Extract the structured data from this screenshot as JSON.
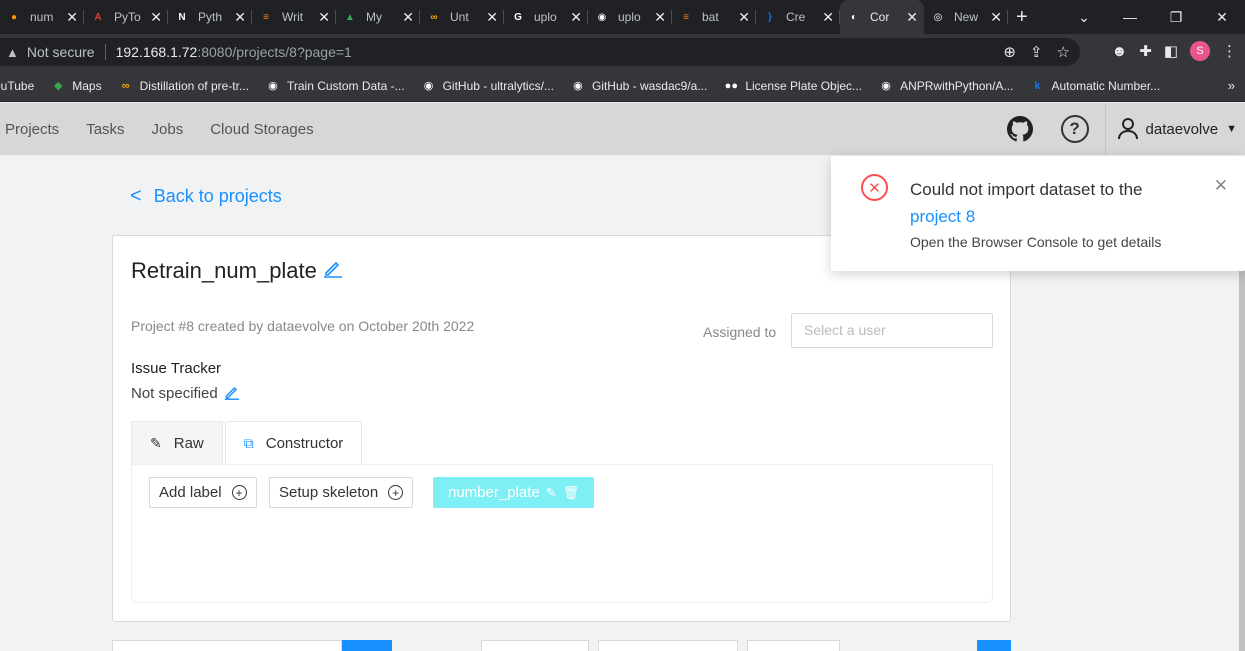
{
  "browser": {
    "tabs": [
      {
        "label": "num",
        "fav_color": "#f29900",
        "fav_char": "●"
      },
      {
        "label": "PyTo",
        "fav_color": "#e53935",
        "fav_char": "A"
      },
      {
        "label": "Pyth",
        "fav_color": "#ffffff",
        "fav_char": "N"
      },
      {
        "label": "Writ",
        "fav_color": "#f48024",
        "fav_char": "≡"
      },
      {
        "label": "My",
        "fav_color": "#34a853",
        "fav_char": "▲"
      },
      {
        "label": "Unt",
        "fav_color": "#f9ab00",
        "fav_char": "∞"
      },
      {
        "label": "uplo",
        "fav_color": "#ffffff",
        "fav_char": "G"
      },
      {
        "label": "uplo",
        "fav_color": "#ffffff",
        "fav_char": "◉"
      },
      {
        "label": "bat",
        "fav_color": "#f48024",
        "fav_char": "≡"
      },
      {
        "label": "Cre",
        "fav_color": "#1a73e8",
        "fav_char": "}"
      },
      {
        "label": "Cor",
        "fav_color": "#ffffff",
        "fav_char": "◐"
      },
      {
        "label": "New",
        "fav_color": "#ffffff",
        "fav_char": "◎"
      }
    ],
    "new_tab": "+",
    "address": {
      "not_secure": "Not secure",
      "host": "192.168.1.72",
      "path": ":8080/projects/8?page=1"
    },
    "bookmarks": [
      {
        "label": "ouTube",
        "icon_color": "#ff0000",
        "icon_char": "▶"
      },
      {
        "label": "Maps",
        "icon_color": "#34a853",
        "icon_char": "◆"
      },
      {
        "label": "Distillation of pre-tr...",
        "icon_color": "#f9ab00",
        "icon_char": "∞"
      },
      {
        "label": "Train Custom Data -...",
        "icon_color": "#ffffff",
        "icon_char": "◉"
      },
      {
        "label": "GitHub - ultralytics/...",
        "icon_color": "#ffffff",
        "icon_char": "◉"
      },
      {
        "label": "GitHub - wasdac9/a...",
        "icon_color": "#ffffff",
        "icon_char": "◉"
      },
      {
        "label": "License Plate Objec...",
        "icon_color": "#ffffff",
        "icon_char": "●●"
      },
      {
        "label": "ANPRwithPython/A...",
        "icon_color": "#ffffff",
        "icon_char": "◉"
      },
      {
        "label": "Automatic Number...",
        "icon_color": "#1a73e8",
        "icon_char": "k"
      }
    ],
    "bookmarks_more": "»",
    "profile_letter": "S"
  },
  "header": {
    "nav": [
      "Projects",
      "Tasks",
      "Jobs",
      "Cloud Storages"
    ],
    "help": "?",
    "username": "dataevolve"
  },
  "main": {
    "back_label": "Back to projects",
    "project": {
      "title": "Retrain_num_plate",
      "meta": "Project #8 created by dataevolve on October 20th 2022",
      "assigned_label": "Assigned to",
      "assignee_placeholder": "Select a user",
      "issue_tracker_title": "Issue Tracker",
      "issue_tracker_value": "Not specified"
    },
    "tabs": [
      {
        "label": "Raw",
        "active": false
      },
      {
        "label": "Constructor",
        "active": true
      }
    ],
    "add_label": "Add label",
    "setup_skeleton": "Setup skeleton",
    "labels": [
      {
        "name": "number_plate",
        "color": "#7ef0f5"
      }
    ]
  },
  "notification": {
    "message": "Could not import dataset to the",
    "link": "project 8",
    "description": "Open the Browser Console to get details"
  }
}
